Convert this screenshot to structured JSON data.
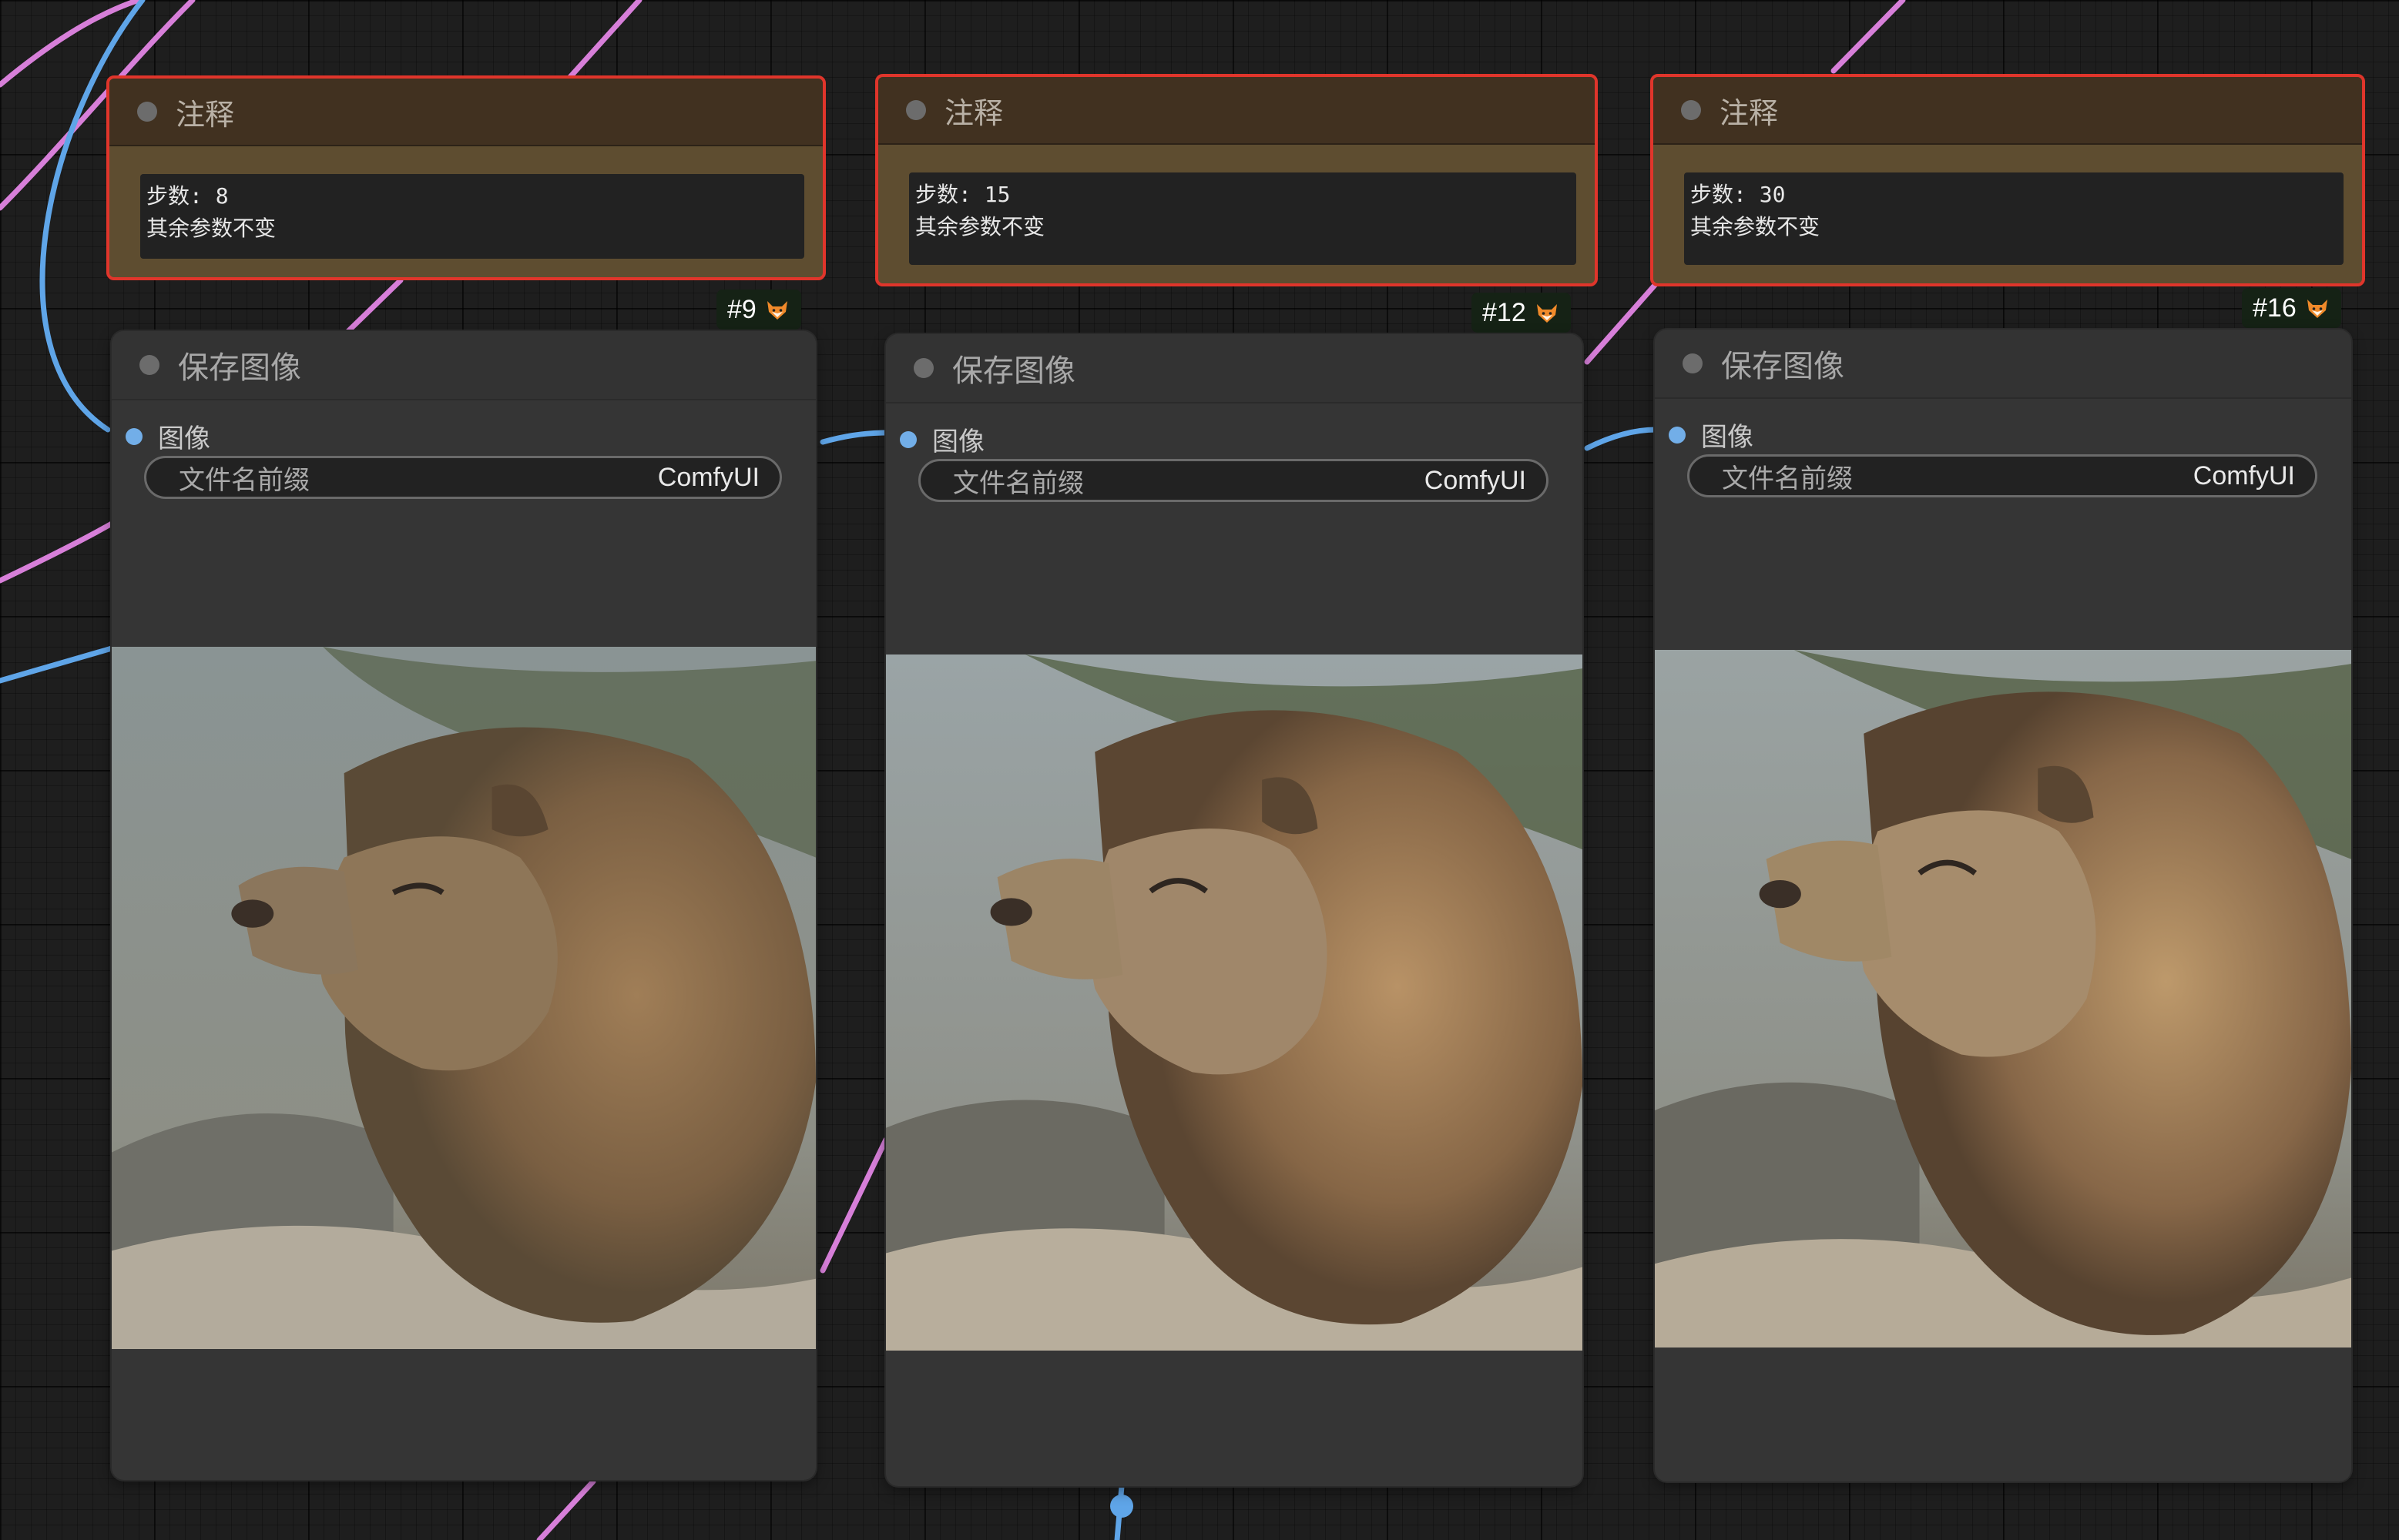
{
  "colors": {
    "canvas": "#1e1e1e",
    "note_border": "#e0352b",
    "note_body": "#5e4d30",
    "note_header": "#413120",
    "node_body": "#353535",
    "link_pink": "#d77fd9",
    "link_blue": "#5fa5e8",
    "input_dot": "#72aee8"
  },
  "notes": [
    {
      "title": "注释",
      "text": "步数: 8\n其余参数不变"
    },
    {
      "title": "注释",
      "text": "步数: 15\n其余参数不变"
    },
    {
      "title": "注释",
      "text": "步数: 30\n其余参数不变"
    }
  ],
  "save_nodes": [
    {
      "id": "#9",
      "title": "保存图像",
      "input_label": "图像",
      "widget_label": "文件名前缀",
      "widget_value": "ComfyUI",
      "badge_icon": "fox-icon",
      "preview": "lion-portrait"
    },
    {
      "id": "#12",
      "title": "保存图像",
      "input_label": "图像",
      "widget_label": "文件名前缀",
      "widget_value": "ComfyUI",
      "badge_icon": "fox-icon",
      "preview": "lion-portrait"
    },
    {
      "id": "#16",
      "title": "保存图像",
      "input_label": "图像",
      "widget_label": "文件名前缀",
      "widget_value": "ComfyUI",
      "badge_icon": "fox-icon",
      "preview": "lion-portrait"
    }
  ]
}
